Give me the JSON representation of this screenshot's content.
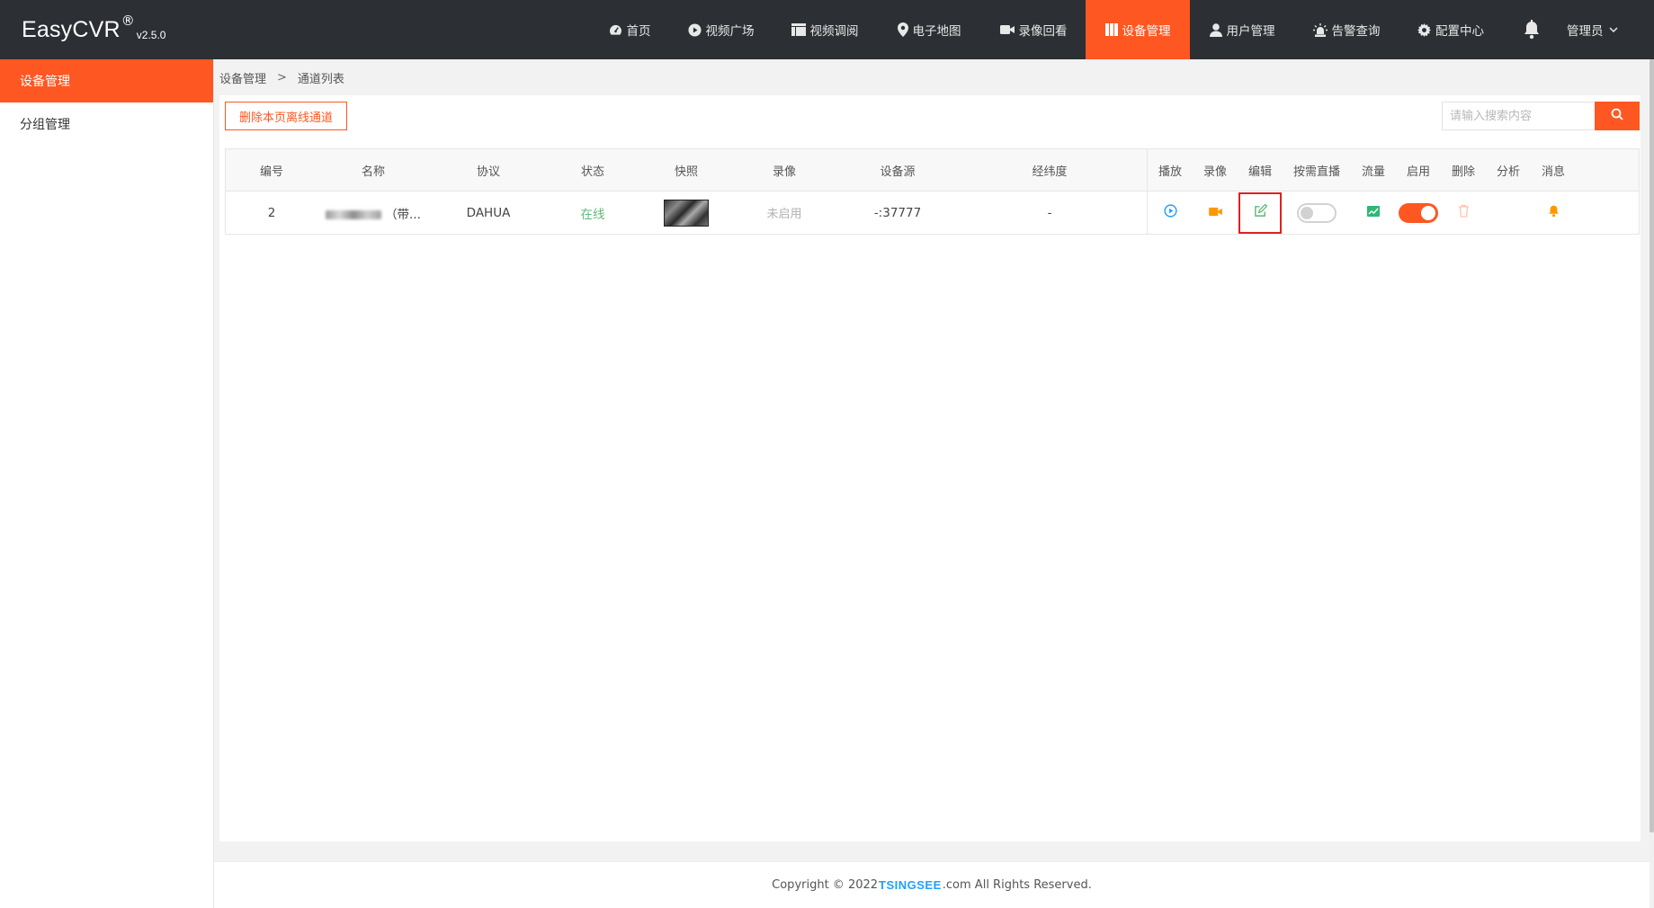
{
  "app": {
    "name": "EasyCVR",
    "reg": "®",
    "version": "v2.5.0"
  },
  "nav": {
    "items": [
      {
        "label": "首页",
        "icon": "dashboard-icon"
      },
      {
        "label": "视频广场",
        "icon": "play-circle-icon"
      },
      {
        "label": "视频调阅",
        "icon": "layout-icon"
      },
      {
        "label": "电子地图",
        "icon": "map-pin-icon"
      },
      {
        "label": "录像回看",
        "icon": "video-camera-icon"
      },
      {
        "label": "设备管理",
        "icon": "device-icon",
        "active": true
      },
      {
        "label": "用户管理",
        "icon": "user-icon"
      },
      {
        "label": "告警查询",
        "icon": "alarm-icon"
      },
      {
        "label": "配置中心",
        "icon": "gear-icon"
      }
    ],
    "user": "管理员"
  },
  "sidebar": {
    "items": [
      {
        "label": "设备管理",
        "active": true
      },
      {
        "label": "分组管理"
      }
    ]
  },
  "breadcrumb": {
    "parent": "设备管理",
    "separator": ">",
    "current": "通道列表"
  },
  "toolbar": {
    "delete_offline_label": "删除本页离线通道",
    "search_placeholder": "请输入搜索内容"
  },
  "table": {
    "headers": {
      "id": "编号",
      "name": "名称",
      "protocol": "协议",
      "status": "状态",
      "snapshot": "快照",
      "record": "录像",
      "source": "设备源",
      "geo": "经纬度",
      "play": "播放",
      "rec": "录像",
      "edit": "编辑",
      "ondemand": "按需直播",
      "flow": "流量",
      "enable": "启用",
      "delete": "删除",
      "analyze": "分析",
      "message": "消息"
    },
    "rows": [
      {
        "id": "2",
        "name_suffix": "（带...",
        "protocol": "DAHUA",
        "status": "在线",
        "record": "未启用",
        "source": "-:37777",
        "geo": "-",
        "ondemand": false,
        "enabled": true
      }
    ]
  },
  "footer": {
    "prefix": "Copyright © 2022 ",
    "brand": "TSINGSEE",
    "suffix": ".com All Rights Reserved."
  },
  "colors": {
    "accent": "#ff5722",
    "topbar": "#2c2f33",
    "online": "#5fb878",
    "link": "#1e9fff",
    "highlight": "#e02020"
  }
}
